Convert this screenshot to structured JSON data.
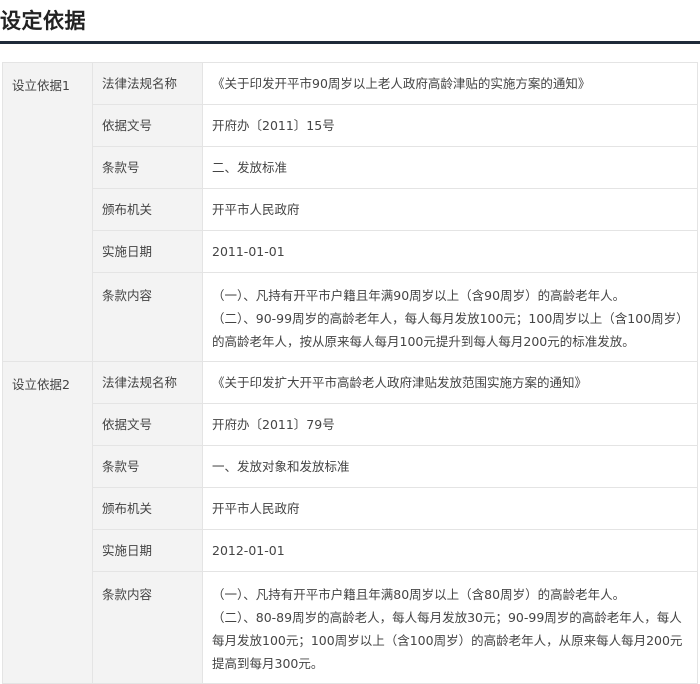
{
  "page": {
    "title": "设定依据"
  },
  "labels": {
    "law_name": "法律法规名称",
    "doc_no": "依据文号",
    "clause_no": "条款号",
    "issuer": "颁布机关",
    "effective_date": "实施日期",
    "clause_content": "条款内容"
  },
  "groups": [
    {
      "label": "设立依据1",
      "law_name": "《关于印发开平市90周岁以上老人政府高龄津贴的实施方案的通知》",
      "doc_no": "开府办〔2011〕15号",
      "clause_no": "二、发放标准",
      "issuer": "开平市人民政府",
      "effective_date": "2011-01-01",
      "content_lines": [
        "（一）、凡持有开平市户籍且年满90周岁以上（含90周岁）的高龄老年人。",
        "（二）、90-99周岁的高龄老年人，每人每月发放100元；100周岁以上（含100周岁）的高龄老年人，按从原来每人每月100元提升到每人每月200元的标准发放。"
      ]
    },
    {
      "label": "设立依据2",
      "law_name": "《关于印发扩大开平市高龄老人政府津贴发放范围实施方案的通知》",
      "doc_no": "开府办〔2011〕79号",
      "clause_no": "一、发放对象和发放标准",
      "issuer": "开平市人民政府",
      "effective_date": "2012-01-01",
      "content_lines": [
        "（一）、凡持有开平市户籍且年满80周岁以上（含80周岁）的高龄老年人。",
        "（二）、80-89周岁的高龄老人，每人每月发放30元；90-99周岁的高龄老年人，每人每月发放100元；100周岁以上（含100周岁）的高龄老年人，从原来每人每月200元提高到每月300元。"
      ]
    }
  ]
}
